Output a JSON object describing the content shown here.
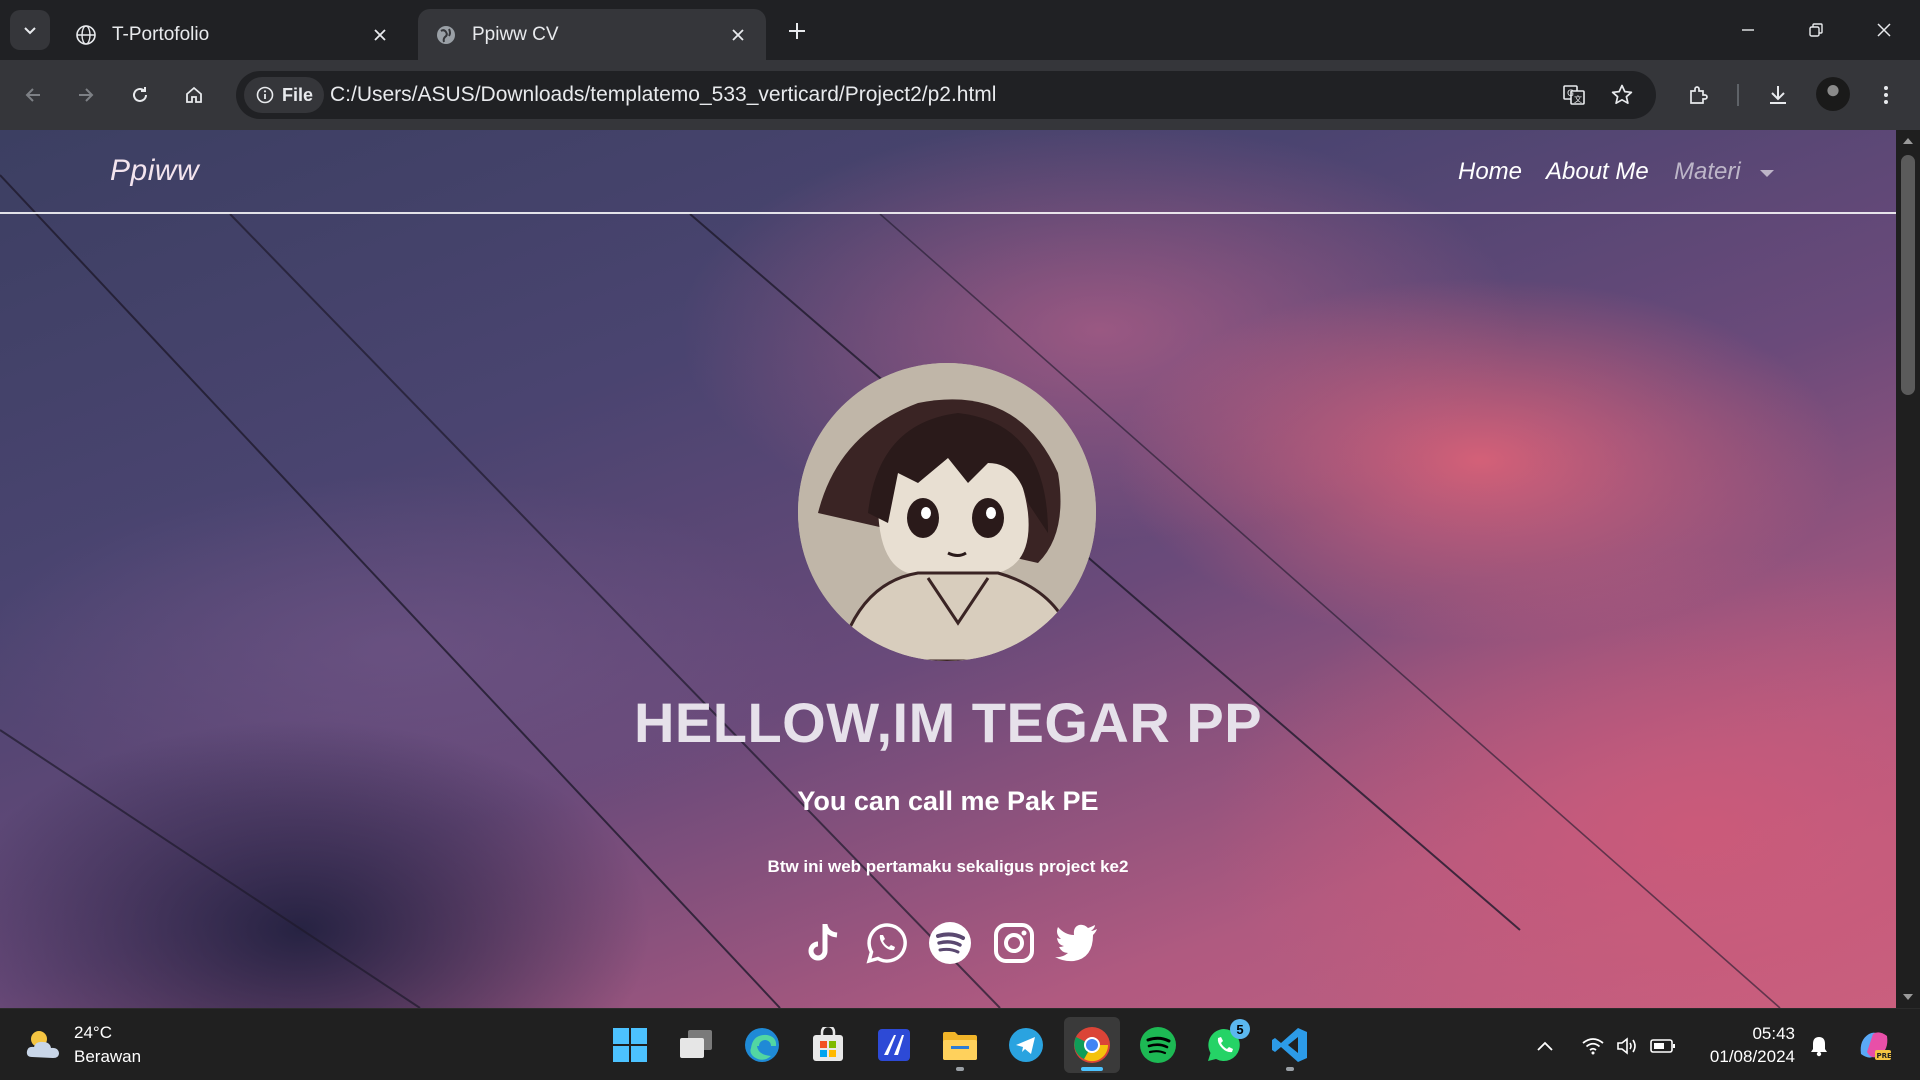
{
  "browser": {
    "tabs": [
      {
        "title": "T-Portofolio",
        "active": false,
        "favicon": "globe-icon"
      },
      {
        "title": "Ppiww CV",
        "active": true,
        "favicon": "globe-icon"
      }
    ],
    "site_chip_label": "File",
    "url": "C:/Users/ASUS/Downloads/templatemo_533_verticard/Project2/p2.html"
  },
  "page": {
    "brand": "Ppiww",
    "nav": [
      {
        "label": "Home"
      },
      {
        "label": "About Me"
      },
      {
        "label": "Materi"
      }
    ],
    "title": "HELLOW,IM TEGAR PP",
    "subtitle": "You can call me Pak PE",
    "note": "Btw ini web pertamaku sekaligus project ke2",
    "socials": [
      "tiktok-icon",
      "whatsapp-icon",
      "spotify-icon",
      "instagram-icon",
      "twitter-icon"
    ]
  },
  "taskbar": {
    "weather": {
      "temp": "24°C",
      "condition": "Berawan"
    },
    "whatsapp_badge": "5",
    "clock": {
      "time": "05:43",
      "date": "01/08/2024"
    }
  },
  "colors": {
    "chrome_dark": "#202124",
    "chrome_toolbar": "#35363a",
    "taskbar": "#202020",
    "accent_blue": "#4cc2ff"
  }
}
